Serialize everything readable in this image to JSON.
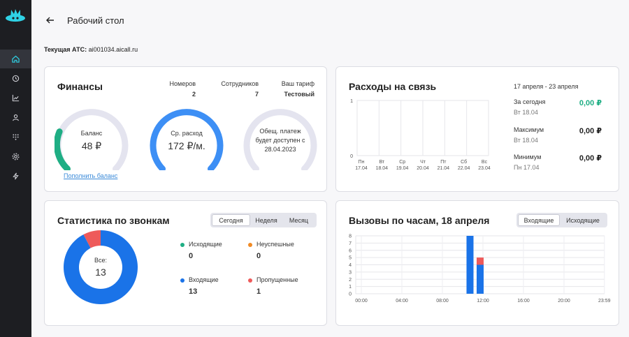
{
  "header": {
    "title": "Рабочий стол"
  },
  "ats": {
    "label": "Текущая АТС:",
    "value": "ai001034.aicall.ru"
  },
  "finance": {
    "title": "Финансы",
    "stats": [
      {
        "label": "Номеров",
        "value": "2"
      },
      {
        "label": "Сотрудников",
        "value": "7"
      },
      {
        "label": "Ваш тариф",
        "value": "Тестовый"
      }
    ],
    "balance_label": "Баланс",
    "balance_value": "48 ₽",
    "expense_label": "Ср. расход",
    "expense_value": "172 ₽/м.",
    "promise_line1": "Обещ. платеж",
    "promise_line2": "будет доступен с",
    "promise_line3": "28.04.2023",
    "topup_link": "Пополнить баланс",
    "colors": {
      "balance": "#1fae84",
      "expense": "#3d8ff5",
      "track": "#e4e4ef"
    }
  },
  "expenses": {
    "title": "Расходы на связь",
    "period": "17 апреля - 23 апреля",
    "rows": [
      {
        "label": "За сегодня",
        "sub": "Вт 18.04",
        "value": "0,00 ₽"
      },
      {
        "label": "Максимум",
        "sub": "Вт 18.04",
        "value": "0,00 ₽"
      },
      {
        "label": "Минимум",
        "sub": "Пн 17.04",
        "value": "0,00 ₽"
      }
    ],
    "today_color": "#1fae84"
  },
  "stats": {
    "title": "Статистика по звонкам",
    "tabs": [
      "Сегодня",
      "Неделя",
      "Месяц"
    ],
    "total_label": "Все:",
    "total_value": "13",
    "legend": [
      {
        "label": "Исходящие",
        "value": "0",
        "color": "#1fae84"
      },
      {
        "label": "Неуспешные",
        "value": "0",
        "color": "#f08a24"
      },
      {
        "label": "Входящие",
        "value": "13",
        "color": "#1a73e8"
      },
      {
        "label": "Пропущенные",
        "value": "1",
        "color": "#ee5a5a"
      }
    ]
  },
  "calls": {
    "title": "Вызовы по часам, 18 апреля",
    "tabs": [
      "Входящие",
      "Исходящие"
    ]
  },
  "chart_data": [
    {
      "type": "bar",
      "title": "Расходы на связь",
      "categories": [
        "Пн\n17.04",
        "Вт\n18.04",
        "Ср\n19.04",
        "Чт\n20.04",
        "Пт\n21.04",
        "Сб\n22.04",
        "Вс\n23.04"
      ],
      "values": [
        0,
        0,
        0,
        0,
        0,
        0,
        0
      ],
      "ylim": [
        0,
        1
      ],
      "yticks": [
        "0",
        "1"
      ]
    },
    {
      "type": "pie",
      "title": "Статистика по звонкам",
      "categories": [
        "Входящие",
        "Пропущенные"
      ],
      "values": [
        12,
        1
      ],
      "colors": [
        "#1a73e8",
        "#ee5a5a"
      ]
    },
    {
      "type": "bar",
      "title": "Вызовы по часам, 18 апреля",
      "x": [
        "11:00",
        "12:00"
      ],
      "series": [
        {
          "values": [
            8,
            4
          ],
          "color": "#1a73e8"
        },
        {
          "values": [
            0,
            1
          ],
          "color": "#ee5a5a"
        }
      ],
      "xticks": [
        "00:00",
        "04:00",
        "08:00",
        "12:00",
        "16:00",
        "20:00",
        "23:59"
      ],
      "ylim": [
        0,
        8
      ],
      "yticks": [
        "0",
        "1",
        "2",
        "3",
        "4",
        "5",
        "6",
        "7",
        "8"
      ]
    }
  ]
}
